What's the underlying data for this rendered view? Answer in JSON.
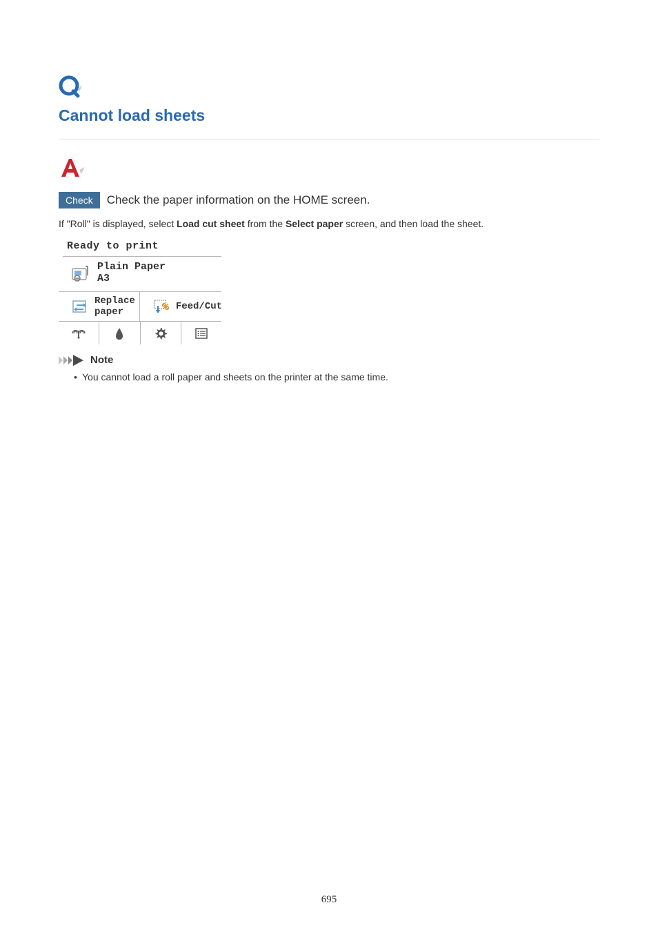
{
  "heading": "Cannot load sheets",
  "check": {
    "badge": "Check",
    "text": "Check the paper information on the HOME screen."
  },
  "body": {
    "prefix": "If \"Roll\" is displayed, select ",
    "bold1": "Load cut sheet",
    "mid": " from the ",
    "bold2": "Select paper",
    "suffix": " screen, and then load the sheet."
  },
  "screen": {
    "status": "Ready to print",
    "paper_type": "Plain Paper",
    "paper_size": "A3",
    "replace_label": "Replace\npaper",
    "feedcut_label": "Feed/Cut"
  },
  "note": {
    "title": "Note",
    "item": "You cannot load a roll paper and sheets on the printer at the same time."
  },
  "page_number": "695"
}
